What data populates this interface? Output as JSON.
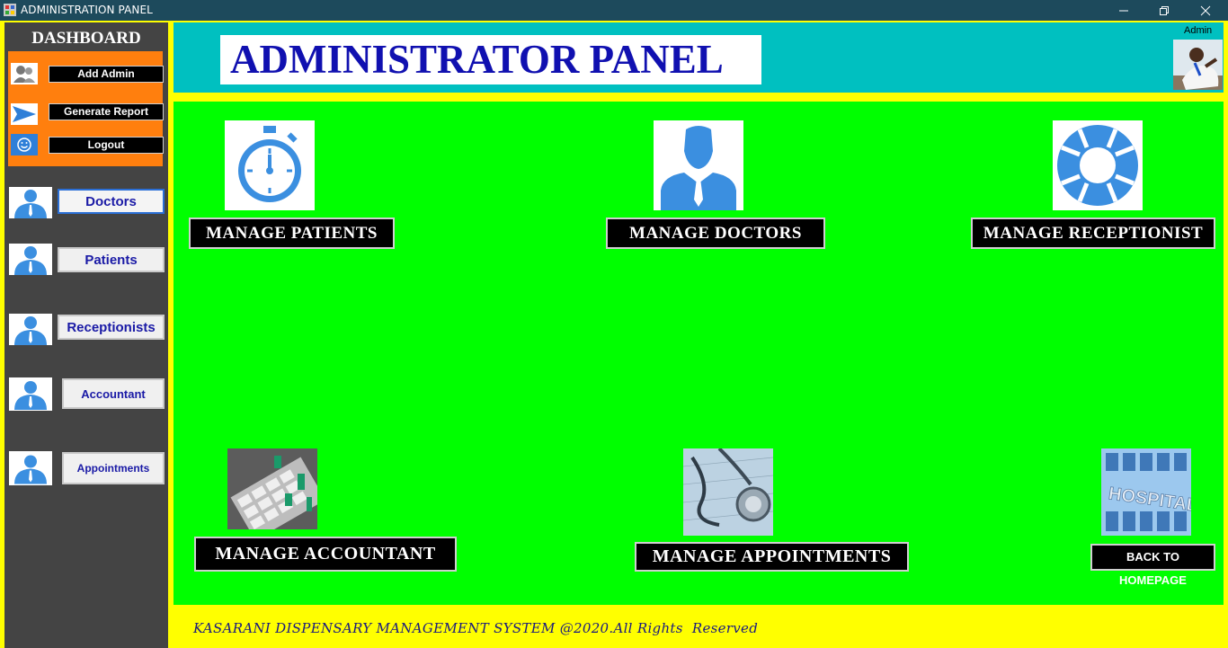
{
  "window": {
    "title": "ADMINISTRATION PANEL"
  },
  "sidebar": {
    "title": "DASHBOARD",
    "quick_actions": [
      {
        "label": "Add Admin",
        "icon": "users-icon"
      },
      {
        "label": "Generate Report",
        "icon": "arrow-right-icon"
      },
      {
        "label": "Logout",
        "icon": "smiley-icon"
      }
    ],
    "nav": [
      {
        "label": "Doctors",
        "icon": "person-icon",
        "selected": true
      },
      {
        "label": "Patients",
        "icon": "person-icon"
      },
      {
        "label": "Receptionists",
        "icon": "person-icon"
      },
      {
        "label": "Accountant",
        "icon": "person-icon"
      },
      {
        "label": "Appointments",
        "icon": "person-icon"
      }
    ]
  },
  "header": {
    "title": "ADMINISTRATOR PANEL",
    "user_label": "Admin"
  },
  "main": {
    "tiles": [
      {
        "label": "MANAGE PATIENTS",
        "icon": "stopwatch-icon"
      },
      {
        "label": "MANAGE DOCTORS",
        "icon": "doctor-icon"
      },
      {
        "label": "MANAGE RECEPTIONIST",
        "icon": "lifebuoy-icon"
      },
      {
        "label": "MANAGE ACCOUNTANT",
        "icon": "calculator-image"
      },
      {
        "label": "MANAGE APPOINTMENTS",
        "icon": "stethoscope-image"
      },
      {
        "label": "BACK TO HOMEPAGE",
        "icon": "hospital-image"
      }
    ]
  },
  "footer": {
    "text": "KASARANI DISPENSARY MANAGEMENT SYSTEM @2020.All Rights  Reserved"
  },
  "colors": {
    "accent_blue": "#3b8fe0",
    "main_bg": "#00ff00",
    "header_bg": "#00c0c0",
    "frame": "#ffff00",
    "quick_bg": "#ff7f0e"
  }
}
